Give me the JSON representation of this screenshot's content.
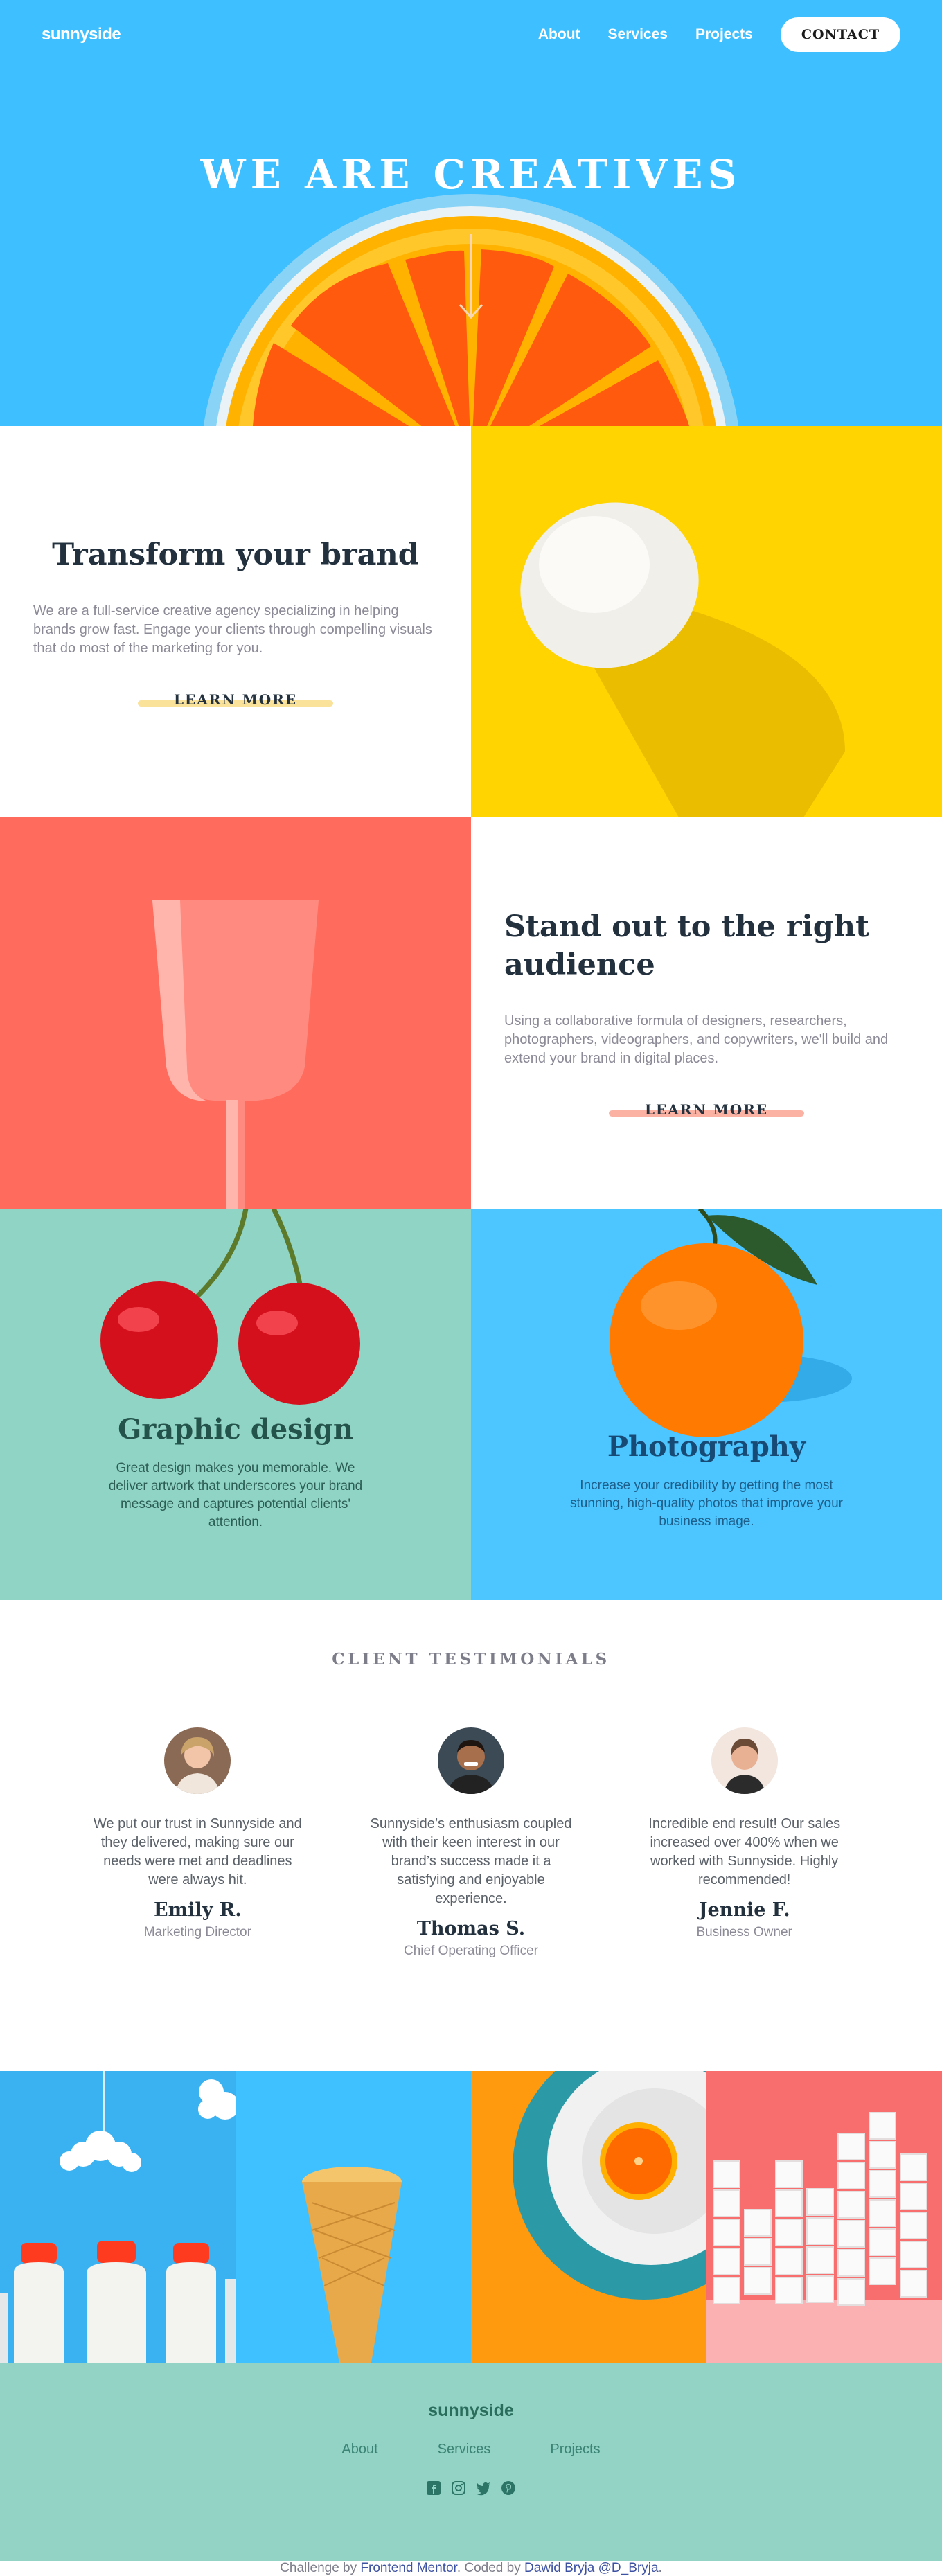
{
  "nav": {
    "logo": "sunnyside",
    "links": [
      "About",
      "Services",
      "Projects"
    ],
    "contact": "CONTACT"
  },
  "hero": {
    "title": "WE ARE CREATIVES",
    "arrow_icon": "arrow-down-icon"
  },
  "transform": {
    "heading": "Transform your brand",
    "body": "We are a full-service creative agency specializing in helping brands grow fast. Engage your clients through compelling visuals that do most of the marketing for you.",
    "link": "LEARN MORE"
  },
  "standout": {
    "heading": "Stand out to the right audience",
    "body": "Using a collaborative formula of designers, researchers, photographers, videographers, and copywriters, we'll build and extend your brand in digital places.",
    "link": "LEARN MORE"
  },
  "graphic": {
    "heading": "Graphic design",
    "body": "Great design makes you memorable. We deliver artwork that underscores your brand message and captures potential clients' attention."
  },
  "photography": {
    "heading": "Photography",
    "body": "Increase your credibility by getting the most stunning, high-quality photos that improve your business image."
  },
  "testimonials": {
    "heading": "CLIENT TESTIMONIALS",
    "items": [
      {
        "quote": "We put our trust in Sunnyside and they delivered, making sure our needs were met and deadlines were always hit.",
        "name": "Emily R.",
        "role": "Marketing Director"
      },
      {
        "quote": "Sunnyside’s enthusiasm coupled with their keen interest in our brand’s success made it a satisfying and enjoyable experience.",
        "name": "Thomas S.",
        "role": "Chief Operating Officer"
      },
      {
        "quote": "Incredible end result! Our sales increased over 400% when we worked with Sunnyside. Highly recommended!",
        "name": "Jennie F.",
        "role": "Business Owner"
      }
    ]
  },
  "footer": {
    "logo": "sunnyside",
    "links": [
      "About",
      "Services",
      "Projects"
    ],
    "social_icons": [
      "facebook-icon",
      "instagram-icon",
      "twitter-icon",
      "pinterest-icon"
    ]
  },
  "attribution": {
    "prefix": "Challenge by ",
    "fm": "Frontend Mentor",
    "middle": ". Coded by ",
    "author": "Dawid Bryja @D_Bryja",
    "suffix": "."
  },
  "colors": {
    "hero_bg": "#3ebfff",
    "yellow": "#ffd400",
    "coral": "#ff6b5c",
    "mint": "#92d3c6",
    "dark": "#23303e"
  }
}
